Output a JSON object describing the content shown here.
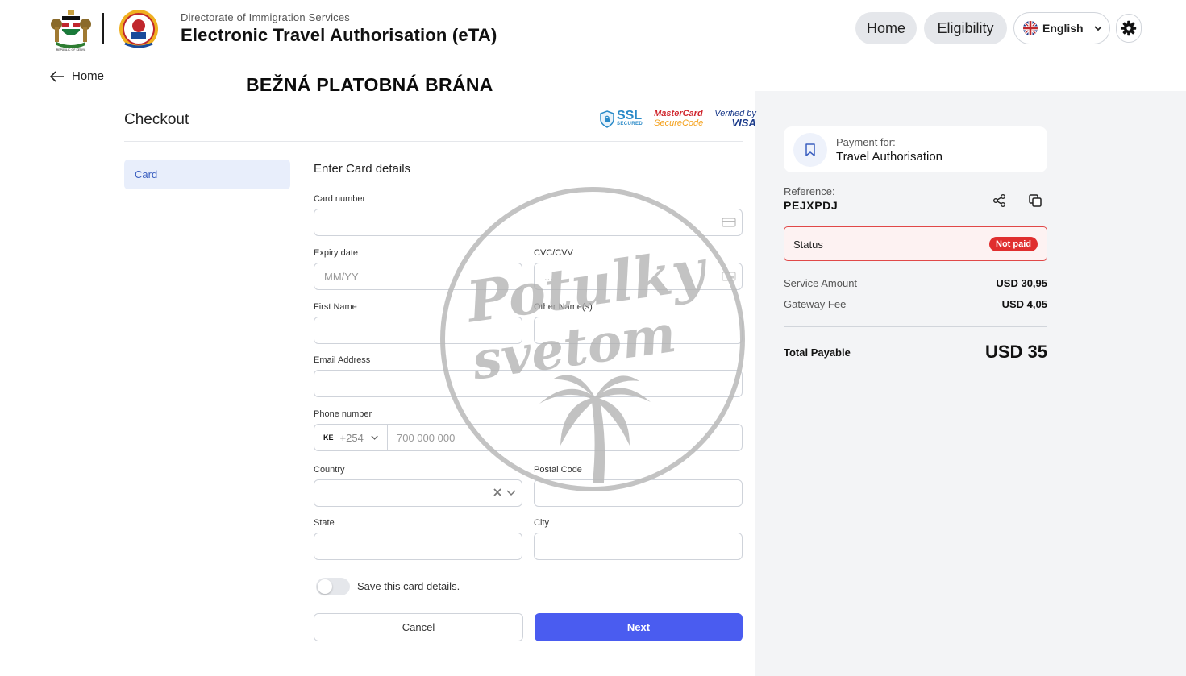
{
  "header": {
    "org_name": "Directorate of Immigration Services",
    "title": "Electronic Travel Authorisation (eTA)",
    "emblem_caption": "REPUBLIC OF KENYA",
    "nav": {
      "home": "Home",
      "eligibility": "Eligibility"
    },
    "language": "English",
    "icons": {
      "language": "uk-flag-icon",
      "dropdown": "chevron-down-icon",
      "settings": "gear-icon"
    }
  },
  "back_link": {
    "label": "Home",
    "icon": "arrow-left-icon"
  },
  "banner": "BEŽNÁ PLATOBNÁ BRÁNA",
  "checkout": {
    "title": "Checkout",
    "badges": {
      "ssl": "SSL",
      "ssl_sub": "SECURED",
      "mastercard_a": "MasterCard",
      "mastercard_b": "SecureCode",
      "visa_a": "Verified by",
      "visa_b": "VISA"
    },
    "tabs": [
      {
        "label": "Card",
        "active": true
      }
    ],
    "section_title": "Enter Card details",
    "fields": {
      "card_number": {
        "label": "Card number",
        "placeholder": ""
      },
      "expiry": {
        "label": "Expiry date",
        "placeholder": "MM/YY"
      },
      "cvc": {
        "label": "CVC/CVV",
        "placeholder": "..."
      },
      "first_name": {
        "label": "First Name",
        "value": ""
      },
      "other_names": {
        "label": "Other Name(s)",
        "value": ""
      },
      "email": {
        "label": "Email Address",
        "value": ""
      },
      "phone": {
        "label": "Phone number",
        "country_flag": "KE",
        "country_code": "+254",
        "placeholder": "700 000 000"
      },
      "country": {
        "label": "Country",
        "value": ""
      },
      "postal_code": {
        "label": "Postal Code",
        "value": ""
      },
      "state": {
        "label": "State",
        "value": ""
      },
      "city": {
        "label": "City",
        "value": ""
      }
    },
    "save_card": {
      "label": "Save this card details.",
      "enabled": false
    },
    "buttons": {
      "cancel": "Cancel",
      "next": "Next"
    }
  },
  "summary": {
    "payment_for_label": "Payment for:",
    "payment_for_value": "Travel Authorisation",
    "reference_label": "Reference:",
    "reference_value": "PEJXPDJ",
    "status_label": "Status",
    "status_value": "Not paid",
    "fees": [
      {
        "label": "Service Amount",
        "value": "USD 30,95"
      },
      {
        "label": "Gateway Fee",
        "value": "USD 4,05"
      }
    ],
    "total_label": "Total Payable",
    "total_value": "USD 35"
  },
  "watermark": {
    "line1": "Potulky",
    "line2": "svetom"
  },
  "colors": {
    "accent": "#4a5cf0",
    "status_red": "#e02e2e",
    "tab_active_bg": "#e8eefb",
    "panel_bg": "#f3f4f6"
  }
}
